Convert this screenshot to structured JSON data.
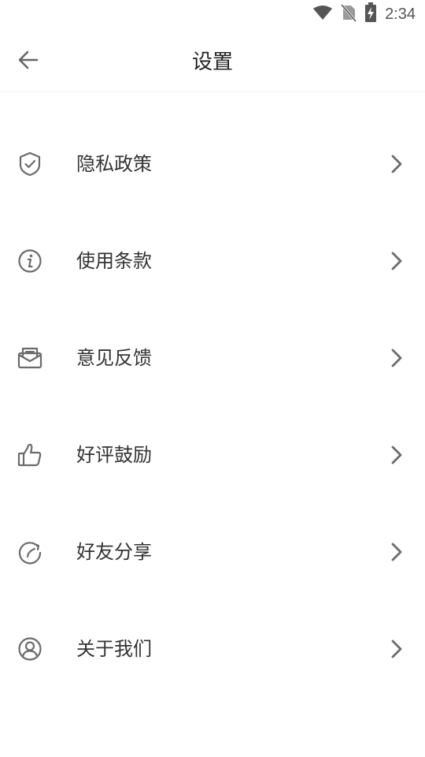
{
  "status_bar": {
    "time": "2:34",
    "icons": [
      "wifi-icon",
      "no-sim-icon",
      "battery-charging-icon"
    ]
  },
  "header": {
    "title": "设置",
    "back_icon": "arrow-left-icon"
  },
  "menu": {
    "items": [
      {
        "label": "隐私政策",
        "icon": "shield-check-icon"
      },
      {
        "label": "使用条款",
        "icon": "info-icon"
      },
      {
        "label": "意见反馈",
        "icon": "feedback-mail-icon"
      },
      {
        "label": "好评鼓励",
        "icon": "thumbs-up-icon"
      },
      {
        "label": "好友分享",
        "icon": "share-refresh-icon"
      },
      {
        "label": "关于我们",
        "icon": "user-circle-icon"
      }
    ]
  },
  "colors": {
    "icon": "#6b6b6b",
    "text": "#333333",
    "divider": "#eeeeee",
    "background": "#ffffff"
  }
}
